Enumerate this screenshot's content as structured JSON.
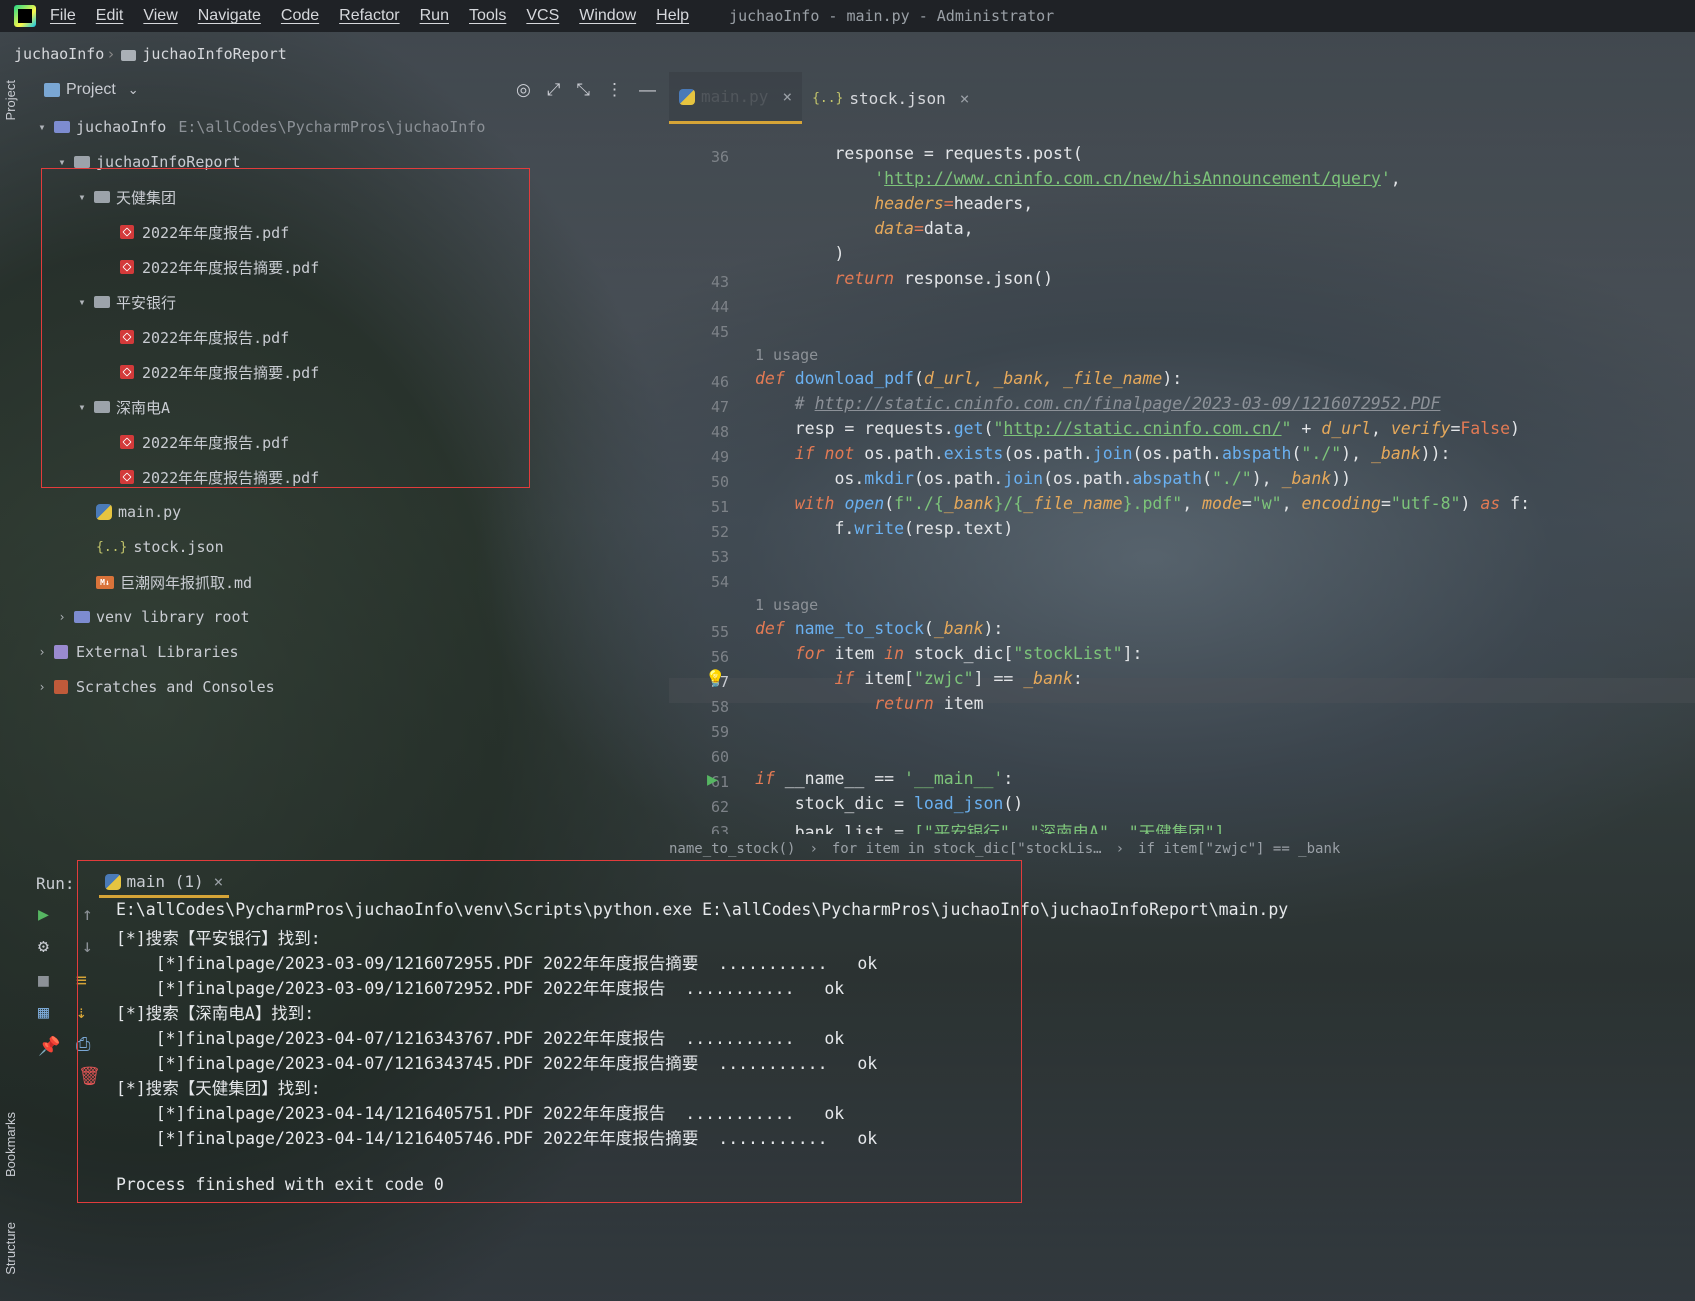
{
  "window": {
    "title": "juchaoInfo - main.py - Administrator"
  },
  "menu": [
    "File",
    "Edit",
    "View",
    "Navigate",
    "Code",
    "Refactor",
    "Run",
    "Tools",
    "VCS",
    "Window",
    "Help"
  ],
  "breadcrumb": {
    "root": "juchaoInfo",
    "child": "juchaoInfoReport"
  },
  "side_strip": {
    "project": "Project",
    "bookmarks": "Bookmarks",
    "structure": "Structure"
  },
  "project_panel": {
    "title": "Project"
  },
  "tree": {
    "root": {
      "name": "juchaoInfo",
      "path": "E:\\allCodes\\PycharmPros\\juchaoInfo"
    },
    "report_folder": "juchaoInfoReport",
    "groups": [
      {
        "name": "天健集团",
        "files": [
          "2022年年度报告.pdf",
          "2022年年度报告摘要.pdf"
        ]
      },
      {
        "name": "平安银行",
        "files": [
          "2022年年度报告.pdf",
          "2022年年度报告摘要.pdf"
        ]
      },
      {
        "name": "深南电A",
        "files": [
          "2022年年度报告.pdf",
          "2022年年度报告摘要.pdf"
        ]
      }
    ],
    "files": [
      "main.py",
      "stock.json",
      "巨潮网年报抓取.md"
    ],
    "venv": "venv  library root",
    "external": "External Libraries",
    "scratches": "Scratches and Consoles"
  },
  "editor_tabs": [
    {
      "label": "main.py",
      "active": true
    },
    {
      "label": "stock.json",
      "active": false
    }
  ],
  "code": {
    "lines": [
      "",
      "36",
      "",
      "",
      "",
      "",
      "43",
      "44",
      "45",
      "",
      "46",
      "47",
      "48",
      "49",
      "50",
      "51",
      "52",
      "53",
      "54",
      "",
      "55",
      "56",
      "57",
      "58",
      "59",
      "60",
      "61",
      "62",
      "63"
    ],
    "usage_label": "1 usage",
    "text": {
      "l1": "        response = requests.post(",
      "url1": "http://www.cninfo.com.cn/new/hisAnnouncement/query",
      "l_headers": "headers",
      "l_data": "data",
      "l_close": ")",
      "ret1": "return",
      "ret1_rest": " response.json()",
      "def1_name": "download_pdf",
      "def1_params": "d_url, _bank, _file_name",
      "comment_url": "http://static.cninfo.com.cn/finalpage/2023-03-09/1216072952.PDF",
      "url2": "http://static.cninfo.com.cn/",
      "def2_name": "name_to_stock",
      "def2_param": "_bank",
      "stocklist": "\"stockList\"",
      "zwjc": "\"zwjc\"",
      "main_str": "'__main__'",
      "bank_list": "[\"平安银行\", \"深南电A\", \"天健集团\"]"
    }
  },
  "code_crumbs": [
    "name_to_stock()",
    "for item in stock_dic[\"stockLis…",
    "if item[\"zwjc\"] == _bank"
  ],
  "run": {
    "label": "Run:",
    "tab": "main (1)",
    "output": [
      "E:\\allCodes\\PycharmPros\\juchaoInfo\\venv\\Scripts\\python.exe E:\\allCodes\\PycharmPros\\juchaoInfo\\juchaoInfoReport\\main.py",
      "[*]搜索【平安银行】找到:",
      "    [*]finalpage/2023-03-09/1216072955.PDF 2022年年度报告摘要  ...........   ok",
      "    [*]finalpage/2023-03-09/1216072952.PDF 2022年年度报告  ...........   ok",
      "[*]搜索【深南电A】找到:",
      "    [*]finalpage/2023-04-07/1216343767.PDF 2022年年度报告  ...........   ok",
      "    [*]finalpage/2023-04-07/1216343745.PDF 2022年年度报告摘要  ...........   ok",
      "[*]搜索【天健集团】找到:",
      "    [*]finalpage/2023-04-14/1216405751.PDF 2022年年度报告  ...........   ok",
      "    [*]finalpage/2023-04-14/1216405746.PDF 2022年年度报告摘要  ...........   ok",
      "",
      "Process finished with exit code 0"
    ]
  },
  "colors": {
    "highlight_box": "#e23c3c",
    "accent_tab": "#d6a437",
    "keyword": "#e37a54",
    "string": "#7dc47a"
  }
}
